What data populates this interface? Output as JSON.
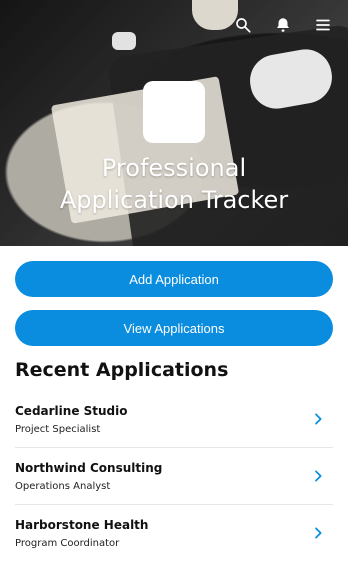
{
  "header": {
    "title_line1": "Professional",
    "title_line2": "Application Tracker",
    "icons": [
      "search-icon",
      "bell-icon",
      "menu-icon"
    ]
  },
  "actions": {
    "add_label": "Add Application",
    "view_label": "View Applications"
  },
  "recent": {
    "heading": "Recent Applications",
    "items": [
      {
        "company": "Cedarline Studio",
        "role": "Project Specialist"
      },
      {
        "company": "Northwind Consulting",
        "role": "Operations Analyst"
      },
      {
        "company": "Harborstone Health",
        "role": "Program Coordinator"
      }
    ]
  },
  "colors": {
    "accent": "#0a8ddf"
  }
}
